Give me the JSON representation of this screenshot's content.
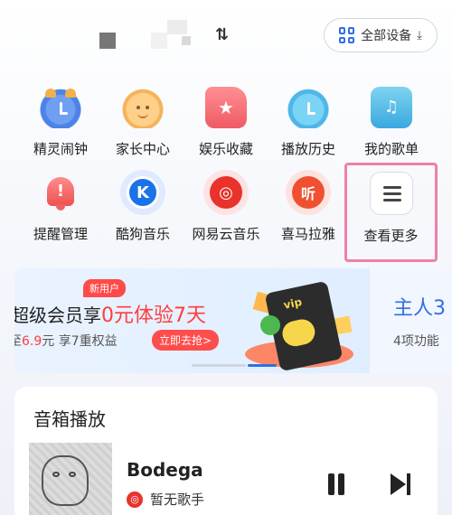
{
  "header": {
    "swap_icon": "⇅",
    "devices_button": "全部设备",
    "devices_arrow": "⤓"
  },
  "apps": [
    {
      "label": "精灵闹钟"
    },
    {
      "label": "家长中心"
    },
    {
      "label": "娱乐收藏"
    },
    {
      "label": "播放历史"
    },
    {
      "label": "我的歌单"
    },
    {
      "label": "提醒管理"
    },
    {
      "label": "酷狗音乐",
      "icon_text": "K"
    },
    {
      "label": "网易云音乐",
      "icon_text": "◎"
    },
    {
      "label": "喜马拉雅",
      "icon_text": "听"
    },
    {
      "label": "查看更多"
    }
  ],
  "banner": {
    "new_user_tag": "新用户",
    "headline_prefix": "超级会员享",
    "headline_free": "0元体验7天",
    "price": "6.9",
    "price_suffix": "元 享7重权益",
    "cta": "立即去抢>",
    "card_vip": "vip"
  },
  "banner2": {
    "title": "主人3",
    "subtitle": "4项功能"
  },
  "player": {
    "section_title": "音箱播放",
    "song_title": "Bodega",
    "artist": "暂无歌手",
    "artist_icon": "◎"
  },
  "colors": {
    "accent": "#2f6fe6",
    "highlight_border": "#f07fa9",
    "promo_red": "#ff3d3d"
  }
}
